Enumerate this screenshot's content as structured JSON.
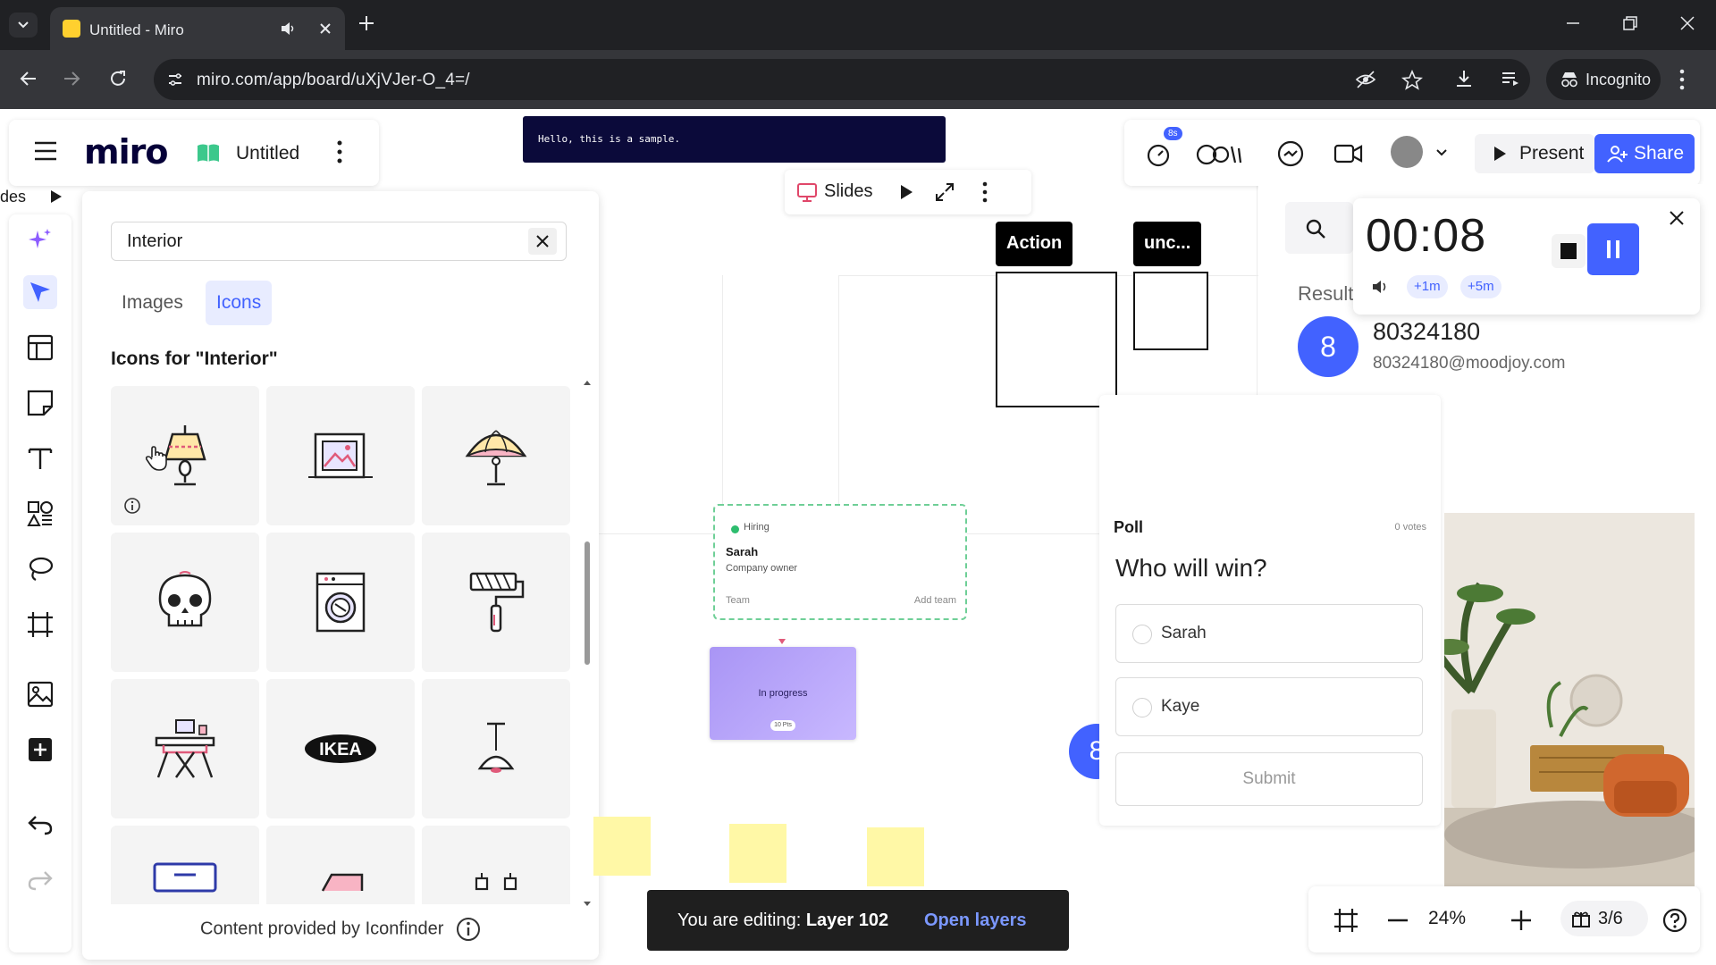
{
  "browser": {
    "tab_title": "Untitled - Miro",
    "url": "miro.com/app/board/uXjVJer-O_4=/",
    "incognito_label": "Incognito"
  },
  "board": {
    "logo": "miro",
    "name": "Untitled",
    "sample_text": "Hello, this is a sample.",
    "timer_badge": "8s",
    "present_label": "Present",
    "share_label": "Share",
    "slides_left_label": "des",
    "slides_label": "Slides"
  },
  "panel": {
    "search_value": "Interior",
    "tabs": [
      "Images",
      "Icons"
    ],
    "active_tab": "Icons",
    "section_title": "Icons for \"Interior\"",
    "icons": [
      "lamp-icon",
      "picture-frame-icon",
      "umbrella-lamp-icon",
      "skull-icon",
      "washing-machine-icon",
      "paint-roller-icon",
      "table-icon",
      "ikea-logo-icon",
      "pendant-lamp-icon",
      "monitor-icon",
      "box-icon",
      "shelf-icon"
    ],
    "ikea_text": "IKEA",
    "credit": "Content provided by Iconfinder"
  },
  "canvas": {
    "action_label": "Action",
    "unc_label": "unc...",
    "hiring": {
      "tag": "Hiring",
      "name": "Sarah",
      "role": "Company owner",
      "team": "Team",
      "add_team": "Add team"
    },
    "in_progress": "In progress",
    "in_progress_pill": "10 Pts",
    "circle_number": "8",
    "poll": {
      "title": "Poll",
      "votes": "0 votes",
      "question": "Who will win?",
      "options": [
        "Sarah",
        "Kaye"
      ],
      "submit": "Submit"
    }
  },
  "right": {
    "results_label": "Result",
    "avatar_letter": "8",
    "user_name": "80324180",
    "user_email": "80324180@moodjoy.com"
  },
  "timer": {
    "time": "00:08",
    "add1": "+1m",
    "add5": "+5m"
  },
  "bottom": {
    "editing_prefix": "You are editing:",
    "editing_layer": "Layer 102",
    "open_layers": "Open layers",
    "zoom": "24%",
    "pages": "3/6"
  },
  "colors": {
    "accent": "#4262ff",
    "dark": "#050038",
    "chrome": "#202124"
  }
}
